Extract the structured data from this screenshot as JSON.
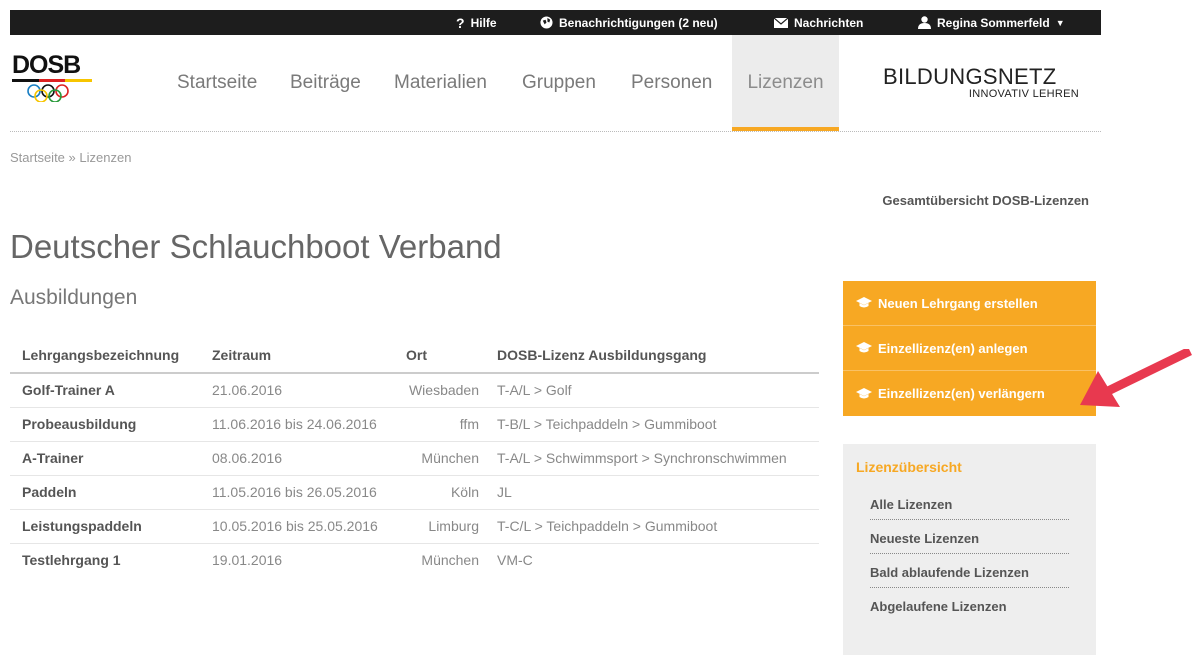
{
  "topbar": {
    "help": "Hilfe",
    "notifications": "Benachrichtigungen (2 neu)",
    "messages": "Nachrichten",
    "user": "Regina Sommerfeld"
  },
  "logo": {
    "text": "DOSB"
  },
  "nav": [
    "Startseite",
    "Beiträge",
    "Materialien",
    "Gruppen",
    "Personen",
    "Lizenzen"
  ],
  "brand": {
    "main": "BILDUNGSNETZ",
    "sub": "INNOVATIV LEHREN"
  },
  "breadcrumb": {
    "home": "Startseite",
    "sep": " » ",
    "current": "Lizenzen"
  },
  "overview_link": "Gesamtübersicht DOSB-Lizenzen",
  "page_title": "Deutscher Schlauchboot Verband",
  "section_title": "Ausbildungen",
  "table": {
    "headers": [
      "Lehrgangsbezeichnung",
      "Zeitraum",
      "Ort",
      "DOSB-Lizenz Ausbildungsgang"
    ],
    "rows": [
      [
        "Golf-Trainer A",
        "21.06.2016",
        "Wiesbaden",
        "T-A/L > Golf"
      ],
      [
        "Probeausbildung",
        "11.06.2016 bis 24.06.2016",
        "ffm",
        "T-B/L > Teichpaddeln > Gummiboot"
      ],
      [
        "A-Trainer",
        "08.06.2016",
        "München",
        "T-A/L > Schwimmsport > Synchronschwimmen"
      ],
      [
        "Paddeln",
        "11.05.2016 bis 26.05.2016",
        "Köln",
        "JL"
      ],
      [
        "Leistungspaddeln",
        "10.05.2016 bis 25.05.2016",
        "Limburg",
        "T-C/L > Teichpaddeln > Gummiboot"
      ],
      [
        "Testlehrgang 1",
        "19.01.2016",
        "München",
        "VM-C"
      ]
    ]
  },
  "actions": [
    "Neuen Lehrgang erstellen",
    "Einzellizenz(en) anlegen",
    "Einzellizenz(en) verlängern"
  ],
  "license_overview": {
    "title": "Lizenzübersicht",
    "items": [
      "Alle Lizenzen",
      "Neueste Lizenzen",
      "Bald ablaufende Lizenzen",
      "Abgelaufene Lizenzen"
    ]
  },
  "colors": {
    "accent": "#f7a823",
    "topbar": "#1d1d1d",
    "arrow": "#e8394f"
  }
}
